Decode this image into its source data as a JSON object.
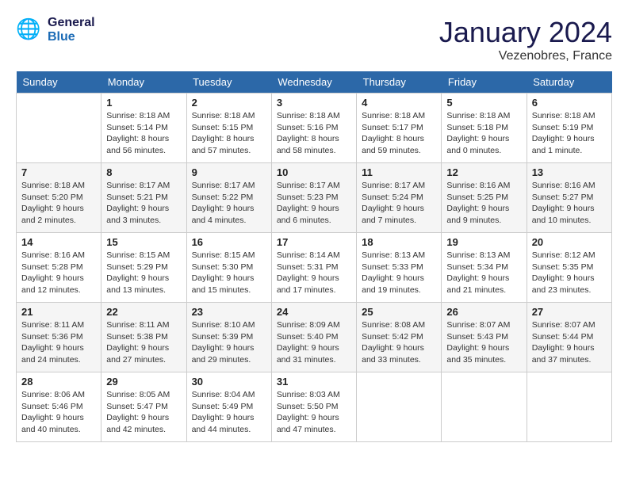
{
  "header": {
    "logo_general": "General",
    "logo_blue": "Blue",
    "month": "January 2024",
    "location": "Vezenobres, France"
  },
  "weekdays": [
    "Sunday",
    "Monday",
    "Tuesday",
    "Wednesday",
    "Thursday",
    "Friday",
    "Saturday"
  ],
  "weeks": [
    [
      {
        "day": "",
        "info": ""
      },
      {
        "day": "1",
        "info": "Sunrise: 8:18 AM\nSunset: 5:14 PM\nDaylight: 8 hours\nand 56 minutes."
      },
      {
        "day": "2",
        "info": "Sunrise: 8:18 AM\nSunset: 5:15 PM\nDaylight: 8 hours\nand 57 minutes."
      },
      {
        "day": "3",
        "info": "Sunrise: 8:18 AM\nSunset: 5:16 PM\nDaylight: 8 hours\nand 58 minutes."
      },
      {
        "day": "4",
        "info": "Sunrise: 8:18 AM\nSunset: 5:17 PM\nDaylight: 8 hours\nand 59 minutes."
      },
      {
        "day": "5",
        "info": "Sunrise: 8:18 AM\nSunset: 5:18 PM\nDaylight: 9 hours\nand 0 minutes."
      },
      {
        "day": "6",
        "info": "Sunrise: 8:18 AM\nSunset: 5:19 PM\nDaylight: 9 hours\nand 1 minute."
      }
    ],
    [
      {
        "day": "7",
        "info": "Sunrise: 8:18 AM\nSunset: 5:20 PM\nDaylight: 9 hours\nand 2 minutes."
      },
      {
        "day": "8",
        "info": "Sunrise: 8:17 AM\nSunset: 5:21 PM\nDaylight: 9 hours\nand 3 minutes."
      },
      {
        "day": "9",
        "info": "Sunrise: 8:17 AM\nSunset: 5:22 PM\nDaylight: 9 hours\nand 4 minutes."
      },
      {
        "day": "10",
        "info": "Sunrise: 8:17 AM\nSunset: 5:23 PM\nDaylight: 9 hours\nand 6 minutes."
      },
      {
        "day": "11",
        "info": "Sunrise: 8:17 AM\nSunset: 5:24 PM\nDaylight: 9 hours\nand 7 minutes."
      },
      {
        "day": "12",
        "info": "Sunrise: 8:16 AM\nSunset: 5:25 PM\nDaylight: 9 hours\nand 9 minutes."
      },
      {
        "day": "13",
        "info": "Sunrise: 8:16 AM\nSunset: 5:27 PM\nDaylight: 9 hours\nand 10 minutes."
      }
    ],
    [
      {
        "day": "14",
        "info": "Sunrise: 8:16 AM\nSunset: 5:28 PM\nDaylight: 9 hours\nand 12 minutes."
      },
      {
        "day": "15",
        "info": "Sunrise: 8:15 AM\nSunset: 5:29 PM\nDaylight: 9 hours\nand 13 minutes."
      },
      {
        "day": "16",
        "info": "Sunrise: 8:15 AM\nSunset: 5:30 PM\nDaylight: 9 hours\nand 15 minutes."
      },
      {
        "day": "17",
        "info": "Sunrise: 8:14 AM\nSunset: 5:31 PM\nDaylight: 9 hours\nand 17 minutes."
      },
      {
        "day": "18",
        "info": "Sunrise: 8:13 AM\nSunset: 5:33 PM\nDaylight: 9 hours\nand 19 minutes."
      },
      {
        "day": "19",
        "info": "Sunrise: 8:13 AM\nSunset: 5:34 PM\nDaylight: 9 hours\nand 21 minutes."
      },
      {
        "day": "20",
        "info": "Sunrise: 8:12 AM\nSunset: 5:35 PM\nDaylight: 9 hours\nand 23 minutes."
      }
    ],
    [
      {
        "day": "21",
        "info": "Sunrise: 8:11 AM\nSunset: 5:36 PM\nDaylight: 9 hours\nand 24 minutes."
      },
      {
        "day": "22",
        "info": "Sunrise: 8:11 AM\nSunset: 5:38 PM\nDaylight: 9 hours\nand 27 minutes."
      },
      {
        "day": "23",
        "info": "Sunrise: 8:10 AM\nSunset: 5:39 PM\nDaylight: 9 hours\nand 29 minutes."
      },
      {
        "day": "24",
        "info": "Sunrise: 8:09 AM\nSunset: 5:40 PM\nDaylight: 9 hours\nand 31 minutes."
      },
      {
        "day": "25",
        "info": "Sunrise: 8:08 AM\nSunset: 5:42 PM\nDaylight: 9 hours\nand 33 minutes."
      },
      {
        "day": "26",
        "info": "Sunrise: 8:07 AM\nSunset: 5:43 PM\nDaylight: 9 hours\nand 35 minutes."
      },
      {
        "day": "27",
        "info": "Sunrise: 8:07 AM\nSunset: 5:44 PM\nDaylight: 9 hours\nand 37 minutes."
      }
    ],
    [
      {
        "day": "28",
        "info": "Sunrise: 8:06 AM\nSunset: 5:46 PM\nDaylight: 9 hours\nand 40 minutes."
      },
      {
        "day": "29",
        "info": "Sunrise: 8:05 AM\nSunset: 5:47 PM\nDaylight: 9 hours\nand 42 minutes."
      },
      {
        "day": "30",
        "info": "Sunrise: 8:04 AM\nSunset: 5:49 PM\nDaylight: 9 hours\nand 44 minutes."
      },
      {
        "day": "31",
        "info": "Sunrise: 8:03 AM\nSunset: 5:50 PM\nDaylight: 9 hours\nand 47 minutes."
      },
      {
        "day": "",
        "info": ""
      },
      {
        "day": "",
        "info": ""
      },
      {
        "day": "",
        "info": ""
      }
    ]
  ]
}
